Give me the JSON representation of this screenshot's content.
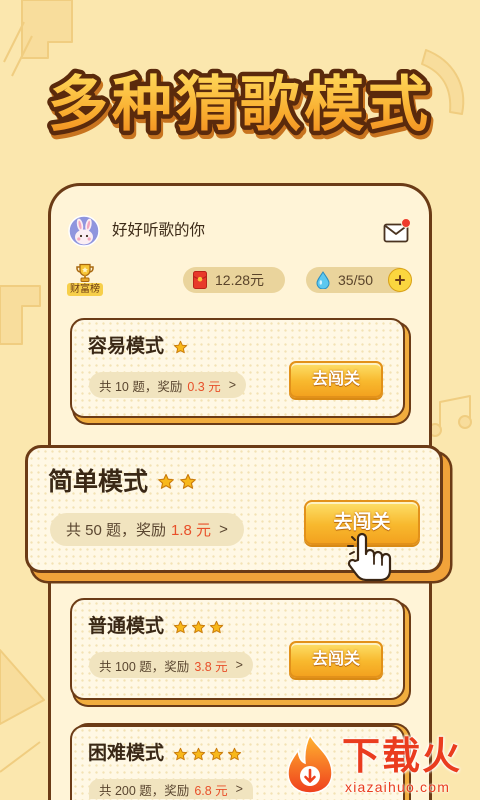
{
  "title": "多种猜歌模式",
  "user": {
    "avatar_icon": "bunny-avatar-icon",
    "name": "好好听歌的你",
    "mail_icon": "mail-icon"
  },
  "leaderboard": {
    "icon": "trophy-icon",
    "label": "财富榜"
  },
  "wallet": {
    "icon": "red-envelope-icon",
    "amount": "12.28元"
  },
  "energy": {
    "icon": "water-drop-icon",
    "value": "35/50",
    "add_icon": "plus-icon"
  },
  "modes": [
    {
      "name": "容易模式",
      "stars": 1,
      "info": "共 10 题，奖励",
      "reward": "0.3 元",
      "arrow": ">",
      "button": "去闯关"
    },
    {
      "name": "简单模式",
      "stars": 2,
      "info": "共 50 题，奖励",
      "reward": "1.8 元",
      "arrow": ">",
      "button": "去闯关"
    },
    {
      "name": "普通模式",
      "stars": 3,
      "info": "共 100 题，奖励",
      "reward": "3.8 元",
      "arrow": ">",
      "button": "去闯关"
    },
    {
      "name": "困难模式",
      "stars": 4,
      "info": "共 200 题，奖励",
      "reward": "6.8 元",
      "arrow": ">"
    }
  ],
  "cursor_icon": "hand-pointer-icon",
  "watermark": {
    "icon": "flame-logo-icon",
    "brand": "下载火",
    "url": "xiazaihuo.com"
  },
  "colors": {
    "background": "#fbe7ae",
    "outline": "#6b3b16",
    "button": "#f8b92e",
    "reward": "#e8502a",
    "star": "#f8b81a",
    "watermark": "#ea3c1e"
  }
}
